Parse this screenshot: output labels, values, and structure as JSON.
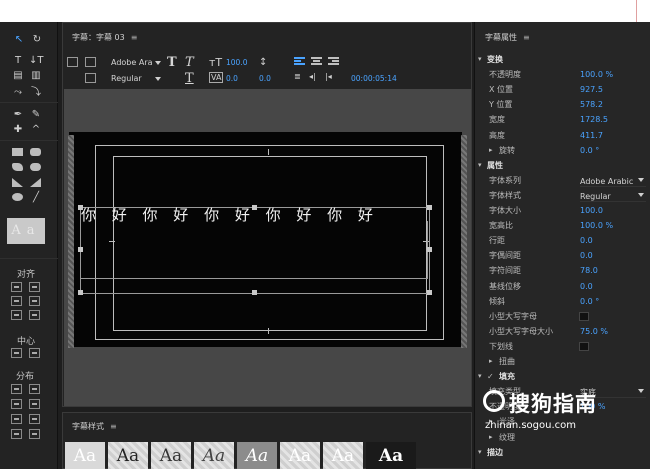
{
  "tools_panel": {
    "align_label": "对齐",
    "center_label": "中心",
    "distribute_label": "分布",
    "preview_text": "Aa"
  },
  "main_panel": {
    "tab_label": "字幕：字幕 03",
    "menu_icon": "≡",
    "font_family": "Adobe Ara",
    "font_style": "Regular",
    "font_size": "100.0",
    "kerning": "0.0",
    "leading": "0.0",
    "timecode": "00:00:05:14",
    "subtitle_text": "你 好 你 好 你 好 你 好 你 好"
  },
  "styles_panel": {
    "tab_label": "字幕样式",
    "menu_icon": "≡",
    "swatches": [
      "Aa",
      "Aa",
      "Aa",
      "Aa",
      "Aa",
      "Aa",
      "Aa",
      "Aa"
    ]
  },
  "props_panel": {
    "title": "字幕属性",
    "menu_icon": "≡",
    "rows": [
      {
        "key": "变换",
        "section": true
      },
      {
        "key": "不透明度",
        "value": "100.0 %"
      },
      {
        "key": "X 位置",
        "value": "927.5"
      },
      {
        "key": "Y 位置",
        "value": "578.2"
      },
      {
        "key": "宽度",
        "value": "1728.5"
      },
      {
        "key": "高度",
        "value": "411.7"
      },
      {
        "key": "旋转",
        "value": "0.0 °",
        "sub": true
      },
      {
        "key": "属性",
        "section": true
      },
      {
        "key": "字体系列",
        "dropdown": "Adobe Arabic"
      },
      {
        "key": "字体样式",
        "dropdown": "Regular"
      },
      {
        "key": "字体大小",
        "value": "100.0"
      },
      {
        "key": "宽高比",
        "value": "100.0 %"
      },
      {
        "key": "行距",
        "value": "0.0"
      },
      {
        "key": "字偶间距",
        "value": "0.0"
      },
      {
        "key": "字符间距",
        "value": "78.0"
      },
      {
        "key": "基线位移",
        "value": "0.0"
      },
      {
        "key": "倾斜",
        "value": "0.0 °"
      },
      {
        "key": "小型大写字母",
        "check": true
      },
      {
        "key": "小型大写字母大小",
        "value": "75.0 %"
      },
      {
        "key": "下划线",
        "check": true
      },
      {
        "key": "扭曲",
        "sub": true
      },
      {
        "key": "填充",
        "section": true,
        "checked": "✓"
      },
      {
        "key": "填充类型",
        "dropdown": "实底"
      },
      {
        "key": "不透明度",
        "value": "100 %"
      },
      {
        "key": "光泽",
        "sub": true
      },
      {
        "key": "纹理",
        "sub": true
      },
      {
        "key": "描边",
        "section": true
      }
    ]
  },
  "watermark": {
    "brand": "搜狗指南",
    "url": "zhinan.sogou.com"
  }
}
